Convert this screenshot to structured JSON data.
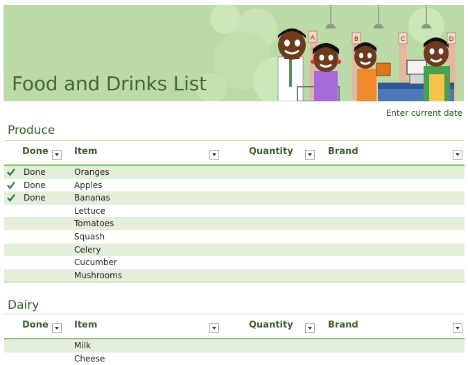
{
  "banner": {
    "title": "Food and Drinks List",
    "aisle_signs": [
      "A",
      "B",
      "C",
      "D"
    ]
  },
  "date_prompt": "Enter current date",
  "produce": {
    "title": "Produce",
    "columns": [
      "Done",
      "Item",
      "Quantity",
      "Brand"
    ],
    "rows": [
      {
        "done": "Done",
        "item": "Oranges"
      },
      {
        "done": "Done",
        "item": "Apples"
      },
      {
        "done": "Done",
        "item": "Bananas"
      },
      {
        "done": "",
        "item": "Lettuce"
      },
      {
        "done": "",
        "item": "Tomatoes"
      },
      {
        "done": "",
        "item": "Squash"
      },
      {
        "done": "",
        "item": "Celery"
      },
      {
        "done": "",
        "item": "Cucumber"
      },
      {
        "done": "",
        "item": "Mushrooms"
      }
    ]
  },
  "dairy": {
    "title": "Dairy",
    "columns": [
      "Done",
      "Item",
      "Quantity",
      "Brand"
    ],
    "rows": [
      {
        "done": "",
        "item": "Milk"
      },
      {
        "done": "",
        "item": "Cheese"
      }
    ]
  },
  "colors": {
    "accent": "#8bbf72",
    "band": "#e3efdb",
    "title": "#3f6a2a",
    "check": "#2f7d3a"
  },
  "icons": {
    "done_marker": "checkmark-icon",
    "column_filter": "dropdown-filter-icon"
  }
}
